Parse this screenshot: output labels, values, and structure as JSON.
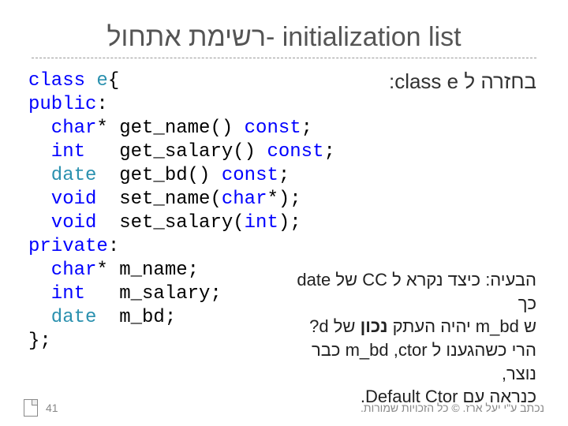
{
  "title": "רשימת אתחול- initialization list",
  "subtitle": "בחזרה ל class e:",
  "code": {
    "l1a": "class ",
    "l1b": "e",
    "l1c": "{",
    "l2": "public",
    "l2b": ":",
    "l3a": "  char",
    "l3b": "* get_name() ",
    "l3c": "const",
    "l3d": ";",
    "l4a": "  int",
    "l4b": "   get_salary() ",
    "l4c": "const",
    "l4d": ";",
    "l5a": "  date",
    "l5b": "  get_bd() ",
    "l5c": "const",
    "l5d": ";",
    "l6a": "  void",
    "l6b": "  set_name(",
    "l6c": "char",
    "l6d": "*);",
    "l7a": "  void",
    "l7b": "  set_salary(",
    "l7c": "int",
    "l7d": ");",
    "l8": "private",
    "l8b": ":",
    "l9a": "  char",
    "l9b": "* m_name;",
    "l10a": "  int",
    "l10b": "   m_salary;",
    "l11a": "  date",
    "l11b": "  m_bd;",
    "l12": "};"
  },
  "annotation": {
    "line1_a": "הבעיה: כיצד נקרא ל CC של date כך",
    "line2_a": "ש m_bd יהיה העתק ",
    "line2_bold": "נכון",
    "line2_b": " של d?",
    "line3": "הרי כשהגענו ל m_bd ,ctor כבר נוצר,",
    "line4": "כנראה עם Default Ctor."
  },
  "footer": {
    "page": "41",
    "credit": "נכתב ע\"י יעל ארז. © כל הזכויות שמורות."
  }
}
